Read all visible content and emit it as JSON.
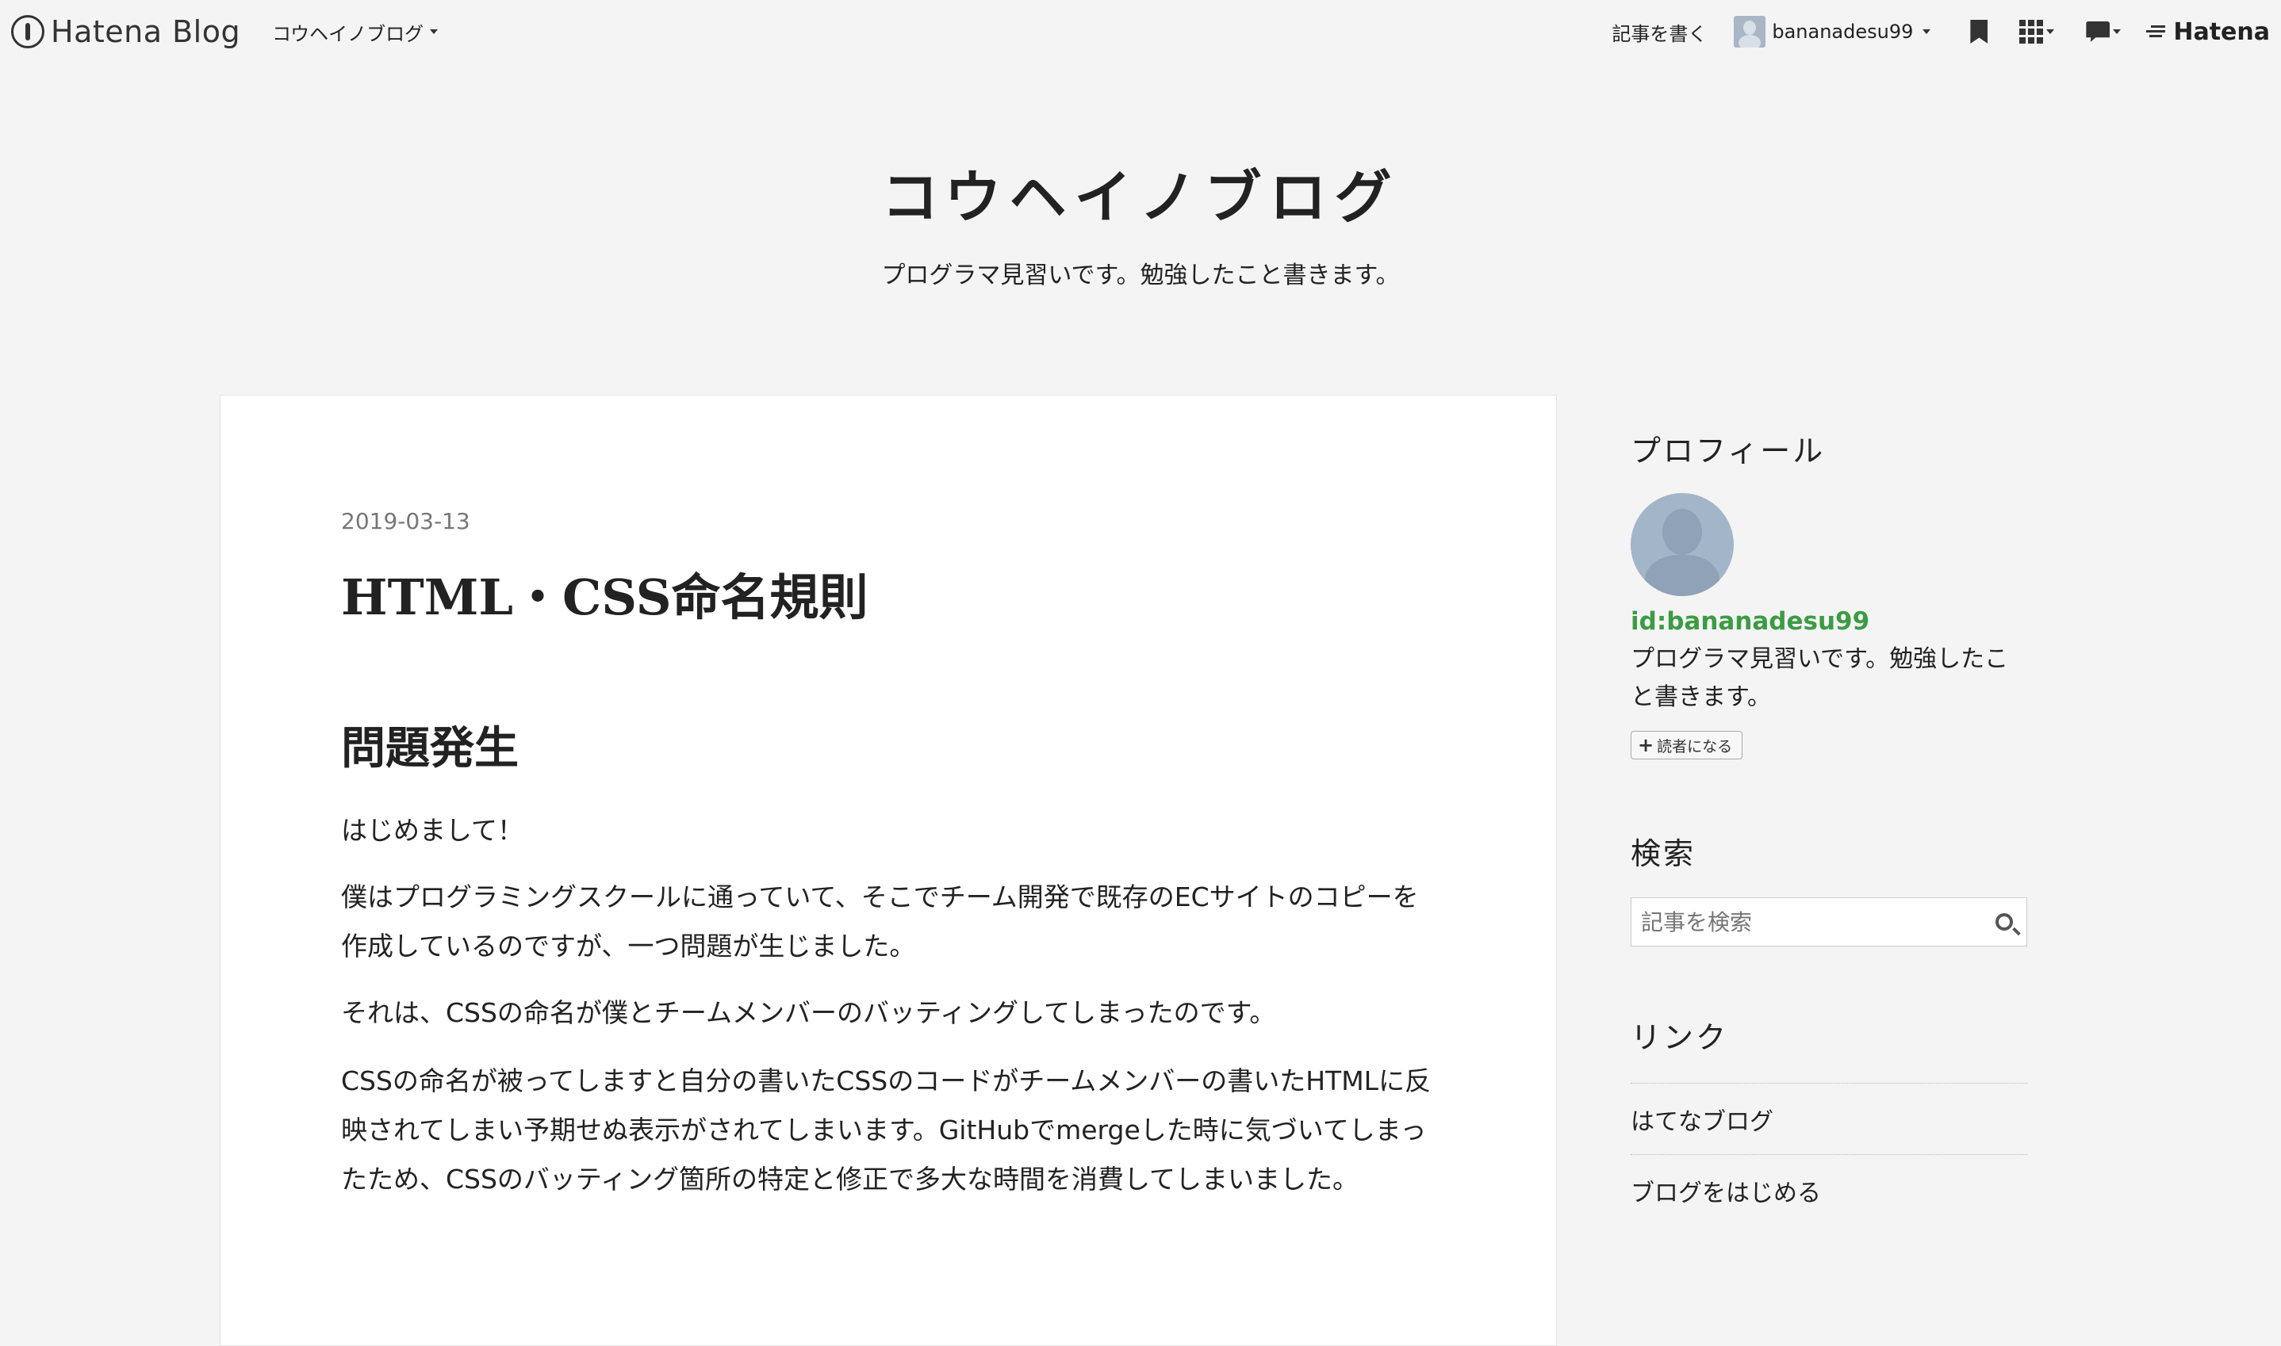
{
  "globalheader": {
    "brand": "Hatena Blog",
    "blog_menu": "コウヘイノブログ",
    "write_label": "記事を書く",
    "username": "bananadesu99",
    "hatena_label": "Hatena"
  },
  "blog": {
    "title": "コウヘイノブログ",
    "description": "プログラマ見習いです。勉強したこと書きます。"
  },
  "entry": {
    "date": "2019-03-13",
    "title": "HTML・CSS命名規則",
    "heading": "問題発生",
    "paragraphs": [
      "はじめまして！",
      "僕はプログラミングスクールに通っていて、そこでチーム開発で既存のECサイトのコピーを作成しているのですが、一つ問題が生じました。",
      "それは、CSSの命名が僕とチームメンバーのバッティングしてしまったのです。",
      "CSSの命名が被ってしますと自分の書いたCSSのコードがチームメンバーの書いたHTMLに反映されてしまい予期せぬ表示がされてしまいます。GitHubでmergeした時に気づいてしまったため、CSSのバッティング箇所の特定と修正で多大な時間を消費してしまいました。"
    ]
  },
  "sidebar": {
    "profile": {
      "title": "プロフィール",
      "id": "id:bananadesu99",
      "description": "プログラマ見習いです。勉強したこと書きます。",
      "subscribe_label": "読者になる"
    },
    "search": {
      "title": "検索",
      "placeholder": "記事を検索"
    },
    "links": {
      "title": "リンク",
      "items": [
        "はてなブログ",
        "ブログをはじめる"
      ]
    }
  }
}
